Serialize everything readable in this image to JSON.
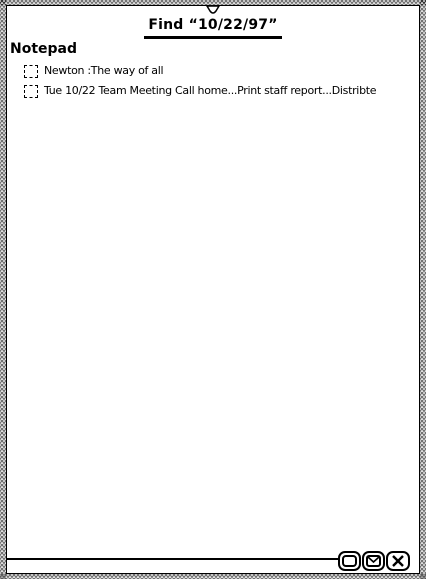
{
  "title": "Find “10/22/97”",
  "section": {
    "header": "Notepad"
  },
  "results": [
    {
      "text": "Newton :The way of all"
    },
    {
      "text": "Tue 10/22 Team Meeting Call home...Print staff report...Distribte"
    }
  ],
  "buttons": {
    "overview_icon": "overview-icon",
    "routing_icon": "envelope-icon",
    "close_icon": "close-icon"
  },
  "colors": {
    "background": "#ffffff",
    "foreground": "#000000",
    "frame": "#c8c8c8"
  }
}
